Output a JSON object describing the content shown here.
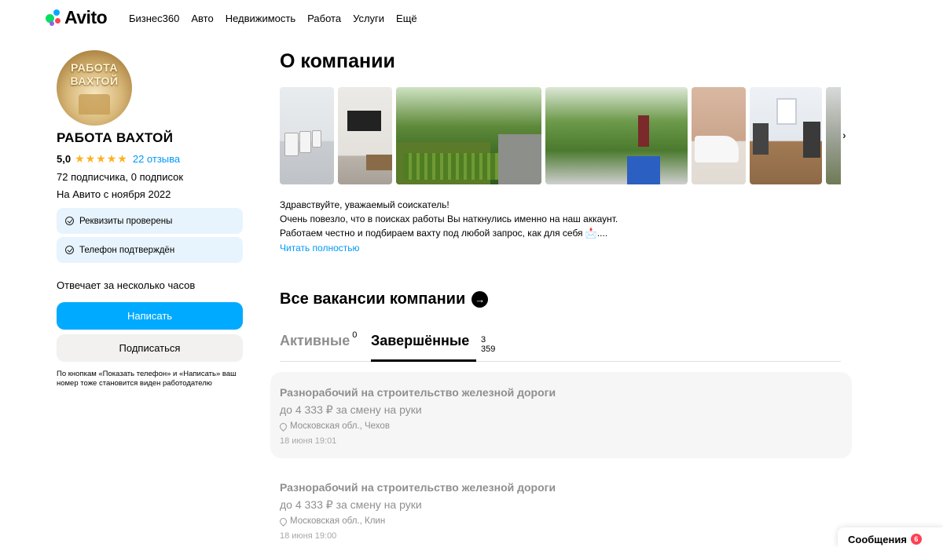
{
  "header": {
    "logo_text": "Avito",
    "nav": [
      "Бизнес360",
      "Авто",
      "Недвижимость",
      "Работа",
      "Услуги",
      "Ещё"
    ]
  },
  "profile": {
    "avatar_text_line1": "РАБОТА",
    "avatar_text_line2": "ВАХТОЙ",
    "name": "РАБОТА ВАХТОЙ",
    "rating": "5,0",
    "stars": "★★★★★",
    "reviews": "22 отзыва",
    "subscribers": "72 подписчика, 0 подписок",
    "since": "На Авито с ноября 2022",
    "badges": [
      "Реквизиты проверены",
      "Телефон подтверждён"
    ],
    "responds": "Отвечает за несколько часов",
    "write_button": "Написать",
    "subscribe_button": "Подписаться",
    "disclaimer": "По кнопкам «Показать телефон» и «Написать» ваш номер тоже становится виден работодателю"
  },
  "about": {
    "title": "О компании",
    "description_lines": [
      "Здравствуйте, уважаемый соискатель!",
      "Очень повезло, что в поисках работы Вы наткнулись именно на наш аккаунт.",
      "Работаем честно и подбираем вахту под любой запрос, как для себя 📩...."
    ],
    "read_more": "Читать полностью",
    "gallery_next": "›"
  },
  "vacancies": {
    "title": "Все вакансии компании",
    "arrow": "→",
    "tabs": [
      {
        "label": "Активные",
        "count": "0"
      },
      {
        "label": "Завершённые",
        "count": "3 359"
      }
    ],
    "items": [
      {
        "title": "Разнорабочий на строительство железной дороги",
        "salary": "до 4 333 ₽ за смену на руки",
        "location": "Московская обл., Чехов",
        "date": "18 июня 19:01"
      },
      {
        "title": "Разнорабочий на строительство железной дороги",
        "salary": "до 4 333 ₽ за смену на руки",
        "location": "Московская обл., Клин",
        "date": "18 июня 19:00"
      }
    ]
  },
  "messages": {
    "label": "Сообщения",
    "count": "6"
  },
  "colors": {
    "accent_blue": "#00aaff",
    "link_blue": "#0099f7",
    "star": "#ffb021",
    "badge_bg": "#e7f4fd",
    "notify_red": "#ff4053"
  }
}
